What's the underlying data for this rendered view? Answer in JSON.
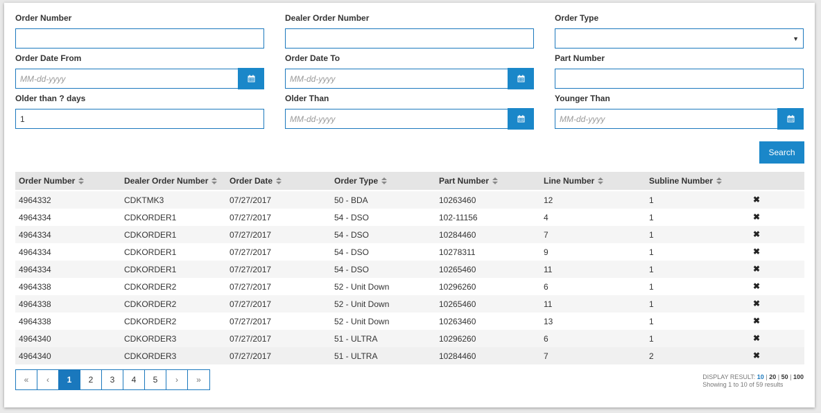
{
  "filters": {
    "order_number": {
      "label": "Order Number",
      "value": ""
    },
    "dealer_order_number": {
      "label": "Dealer Order Number",
      "value": ""
    },
    "order_type": {
      "label": "Order Type",
      "value": ""
    },
    "order_date_from": {
      "label": "Order Date From",
      "placeholder": "MM-dd-yyyy"
    },
    "order_date_to": {
      "label": "Order Date To",
      "placeholder": "MM-dd-yyyy"
    },
    "part_number": {
      "label": "Part Number",
      "value": ""
    },
    "older_than_days": {
      "label": "Older than ? days",
      "value": "1"
    },
    "older_than": {
      "label": "Older Than",
      "placeholder": "MM-dd-yyyy"
    },
    "younger_than": {
      "label": "Younger Than",
      "placeholder": "MM-dd-yyyy"
    }
  },
  "search_label": "Search",
  "table": {
    "columns": [
      "Order Number",
      "Dealer Order Number",
      "Order Date",
      "Order Type",
      "Part Number",
      "Line Number",
      "Subline Number"
    ],
    "delete_glyph": "✖",
    "rows": [
      [
        "4964332",
        "CDKTMK3",
        "07/27/2017",
        "50 - BDA",
        "10263460",
        "12",
        "1"
      ],
      [
        "4964334",
        "CDKORDER1",
        "07/27/2017",
        "54 - DSO",
        "102-11156",
        "4",
        "1"
      ],
      [
        "4964334",
        "CDKORDER1",
        "07/27/2017",
        "54 - DSO",
        "10284460",
        "7",
        "1"
      ],
      [
        "4964334",
        "CDKORDER1",
        "07/27/2017",
        "54 - DSO",
        "10278311",
        "9",
        "1"
      ],
      [
        "4964334",
        "CDKORDER1",
        "07/27/2017",
        "54 - DSO",
        "10265460",
        "11",
        "1"
      ],
      [
        "4964338",
        "CDKORDER2",
        "07/27/2017",
        "52 - Unit Down",
        "10296260",
        "6",
        "1"
      ],
      [
        "4964338",
        "CDKORDER2",
        "07/27/2017",
        "52 - Unit Down",
        "10265460",
        "11",
        "1"
      ],
      [
        "4964338",
        "CDKORDER2",
        "07/27/2017",
        "52 - Unit Down",
        "10263460",
        "13",
        "1"
      ],
      [
        "4964340",
        "CDKORDER3",
        "07/27/2017",
        "51 - ULTRA",
        "10296260",
        "6",
        "1"
      ],
      [
        "4964340",
        "CDKORDER3",
        "07/27/2017",
        "51 - ULTRA",
        "10284460",
        "7",
        "2"
      ]
    ]
  },
  "pagination": {
    "first": "«",
    "prev": "‹",
    "pages": [
      "1",
      "2",
      "3",
      "4",
      "5"
    ],
    "active": "1",
    "next": "›",
    "last": "»"
  },
  "display": {
    "label": "DISPLAY RESULT:",
    "options": [
      "10",
      "20",
      "50",
      "100"
    ],
    "selected": "10",
    "sep": "|",
    "summary": "Showing 1 to 10 of 59 results"
  },
  "colors": {
    "accent": "#1a87c9",
    "border": "#1a78bd",
    "header_bg": "#e5e5e5",
    "stripe": "#f5f5f5"
  },
  "icons": {
    "calendar": "calendar-icon",
    "dropdown": "chevron-down-icon",
    "delete": "close-icon",
    "sort": "sort-icon"
  }
}
